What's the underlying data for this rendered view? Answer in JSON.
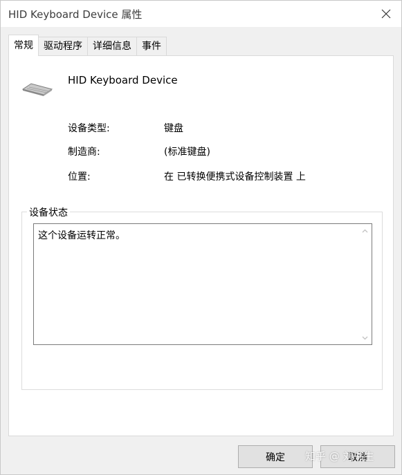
{
  "window": {
    "title": "HID Keyboard Device 属性"
  },
  "tabs": [
    {
      "label": "常规"
    },
    {
      "label": "驱动程序"
    },
    {
      "label": "详细信息"
    },
    {
      "label": "事件"
    }
  ],
  "general": {
    "device_name": "HID Keyboard Device",
    "properties": [
      {
        "label": "设备类型:",
        "value": "键盘"
      },
      {
        "label": "制造商:",
        "value": "(标准键盘)"
      },
      {
        "label": "位置:",
        "value": "在 已转换便携式设备控制装置 上"
      }
    ],
    "status_group_title": "设备状态",
    "status_text": "这个设备运转正常。"
  },
  "buttons": {
    "ok_label": "确定",
    "cancel_label": "取消"
  },
  "watermark": "知乎 @ 刘书生",
  "icons": {
    "close": "close-icon",
    "device": "keyboard-icon",
    "scroll_up": "chevron-up-icon",
    "scroll_down": "chevron-down-icon"
  },
  "colors": {
    "window_bg": "#f0f0f0",
    "panel_bg": "#ffffff",
    "button_bg": "#e1e1e1",
    "border": "#adadad"
  }
}
